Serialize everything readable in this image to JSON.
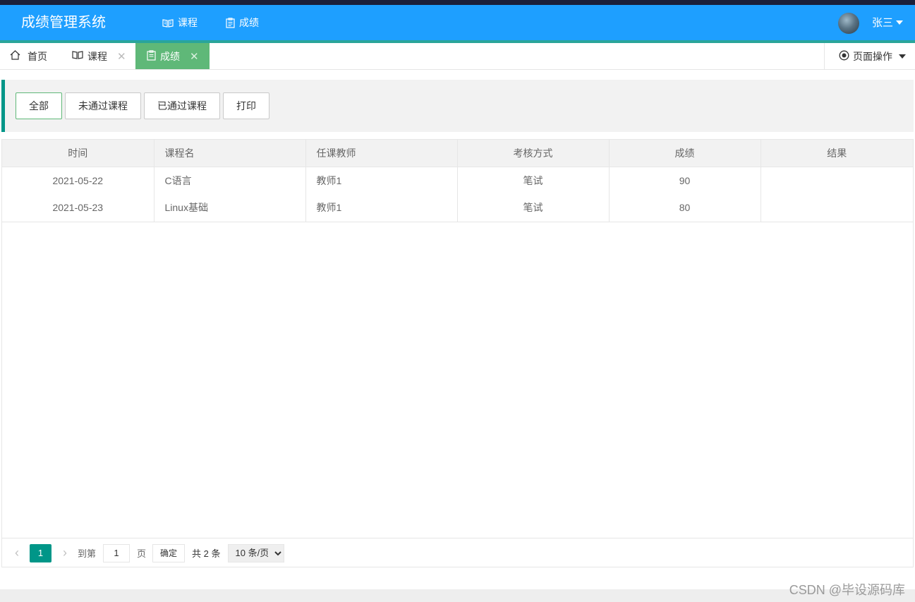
{
  "header": {
    "brand": "成绩管理系统",
    "nav": [
      {
        "label": "课程",
        "icon": "book-icon"
      },
      {
        "label": "成绩",
        "icon": "clipboard-icon"
      }
    ],
    "user_name": "张三"
  },
  "tabs": [
    {
      "label": "首页",
      "icon": "home-icon",
      "closable": false
    },
    {
      "label": "课程",
      "icon": "book-icon",
      "closable": true
    },
    {
      "label": "成绩",
      "icon": "clipboard-icon",
      "closable": true,
      "active": true
    }
  ],
  "page_ops": {
    "label": "页面操作"
  },
  "filters": [
    "全部",
    "未通过课程",
    "已通过课程",
    "打印"
  ],
  "table": {
    "headers": [
      "时间",
      "课程名",
      "任课教师",
      "考核方式",
      "成绩",
      "结果"
    ],
    "rows": [
      [
        "2021-05-22",
        "C语言",
        "教师1",
        "笔试",
        "90",
        ""
      ],
      [
        "2021-05-23",
        "Linux基础",
        "教师1",
        "笔试",
        "80",
        ""
      ]
    ]
  },
  "pager": {
    "current_page": "1",
    "goto_label": "到第",
    "page_input": "1",
    "page_suffix": "页",
    "confirm_label": "确定",
    "total_label": "共 2 条",
    "page_size": "10 条/页"
  },
  "watermark": "CSDN @毕设源码库",
  "colors": {
    "header": "#1e9fff",
    "accent": "#009688",
    "active_tab": "#5fb878"
  }
}
